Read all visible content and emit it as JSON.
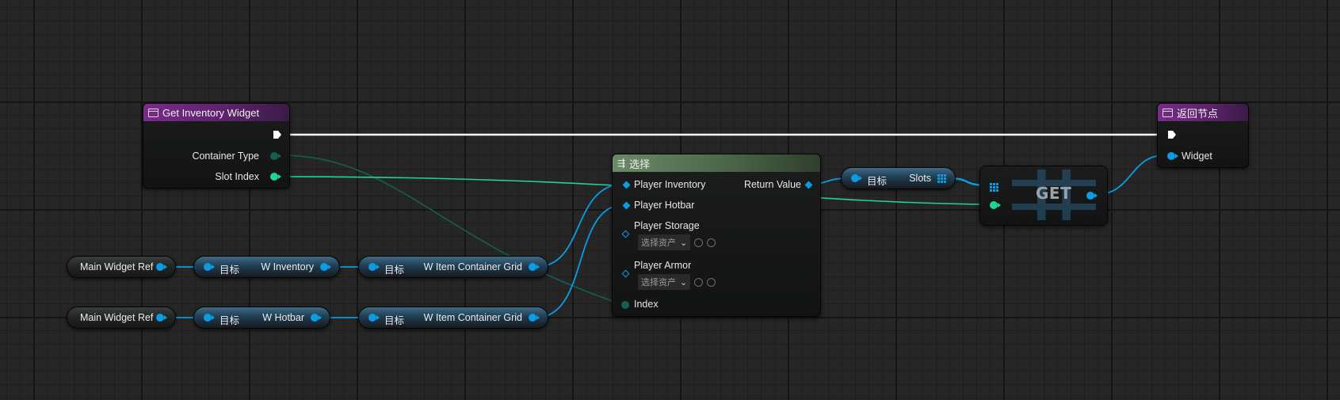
{
  "get_inventory_widget": {
    "title": "Get Inventory Widget",
    "container_type": "Container Type",
    "slot_index": "Slot Index"
  },
  "return_node": {
    "title": "返回节点",
    "widget": "Widget"
  },
  "select_node": {
    "title": "选择",
    "options": [
      "Player Inventory",
      "Player Hotbar",
      "Player Storage",
      "Player Armor"
    ],
    "return_value": "Return Value",
    "asset_picker": "选择资产",
    "index": "Index"
  },
  "slots_node": {
    "target": "目标",
    "slots": "Slots"
  },
  "get_node": {
    "label": "GET"
  },
  "row1": {
    "main_widget_ref": "Main Widget Ref",
    "target1": "目标",
    "w_inventory": "W Inventory",
    "target2": "目标",
    "w_item_container_grid": "W Item Container Grid"
  },
  "row2": {
    "main_widget_ref": "Main Widget Ref",
    "target1": "目标",
    "w_hotbar": "W Hotbar",
    "target2": "目标",
    "w_item_container_grid": "W Item Container Grid"
  },
  "colors": {
    "function_header": "#7a2a8c",
    "select_header": "#6b8a66",
    "object_pin": "#0a9de3",
    "int_pin": "#1fd39a",
    "enum_pin": "#155e52",
    "exec_wire": "#ffffff",
    "background": "#262626"
  },
  "icons": [
    "function-icon",
    "select-icon",
    "exec-pin-icon",
    "dropdown-chevron-icon",
    "use-selected-icon",
    "browse-icon",
    "array-grid-icon"
  ]
}
